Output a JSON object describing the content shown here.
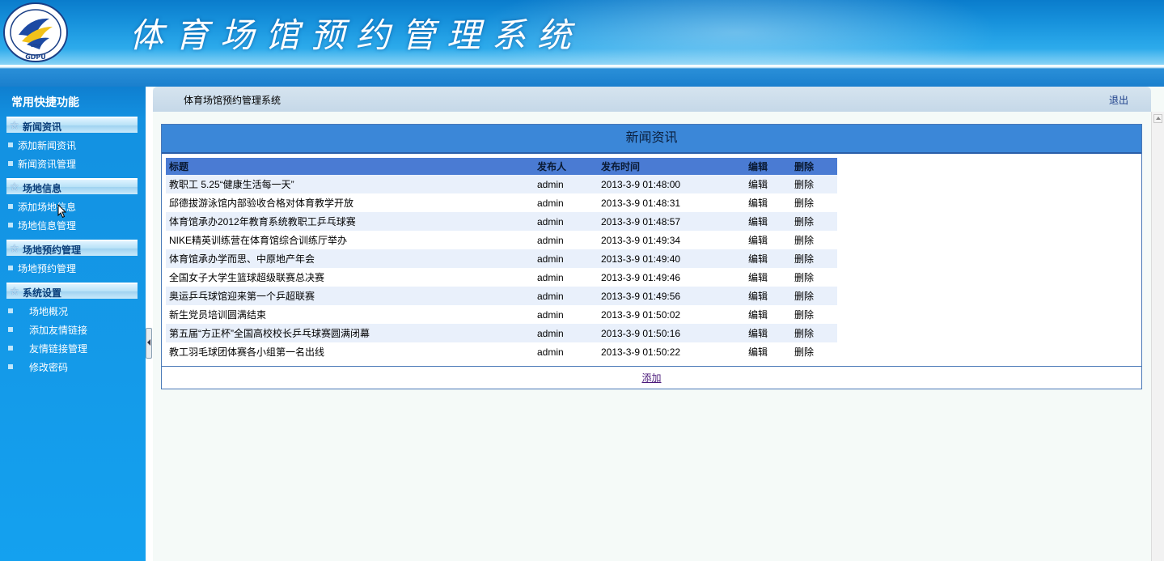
{
  "header": {
    "system_title": "体育场馆预约管理系统",
    "logo": {
      "text_top": "广东体育学院",
      "year": "1958",
      "abbr": "GDPU"
    }
  },
  "sidebar": {
    "title": "常用快捷功能",
    "groups": [
      {
        "label": "新闻资讯",
        "items": [
          {
            "label": "添加新闻资讯"
          },
          {
            "label": "新闻资讯管理"
          }
        ]
      },
      {
        "label": "场地信息",
        "items": [
          {
            "label": "添加场地信息"
          },
          {
            "label": "场地信息管理"
          }
        ]
      },
      {
        "label": "场地预约管理",
        "items": [
          {
            "label": "场地预约管理"
          }
        ]
      },
      {
        "label": "系统设置",
        "items": [
          {
            "label": "场地概况"
          },
          {
            "label": "添加友情链接"
          },
          {
            "label": "友情链接管理"
          },
          {
            "label": "修改密码"
          }
        ]
      }
    ]
  },
  "topbar": {
    "breadcrumb": "体育场馆预约管理系统",
    "logout": "退出"
  },
  "panel": {
    "title": "新闻资讯",
    "columns": [
      "标题",
      "发布人",
      "发布时间",
      "编辑",
      "删除"
    ],
    "rows": [
      {
        "title": "教职工  5.25“健康生活每一天”",
        "author": "admin",
        "time": "2013-3-9 01:48:00",
        "edit": "编辑",
        "delete": "删除"
      },
      {
        "title": "邱德拔游泳馆内部验收合格对体育教学开放",
        "author": "admin",
        "time": "2013-3-9 01:48:31",
        "edit": "编辑",
        "delete": "删除"
      },
      {
        "title": "体育馆承办2012年教育系统教职工乒乓球赛",
        "author": "admin",
        "time": "2013-3-9 01:48:57",
        "edit": "编辑",
        "delete": "删除"
      },
      {
        "title": "NIKE精英训练营在体育馆综合训练厅举办",
        "author": "admin",
        "time": "2013-3-9 01:49:34",
        "edit": "编辑",
        "delete": "删除"
      },
      {
        "title": "体育馆承办学而思、中原地产年会",
        "author": "admin",
        "time": "2013-3-9 01:49:40",
        "edit": "编辑",
        "delete": "删除"
      },
      {
        "title": "全国女子大学生篮球超级联赛总决赛",
        "author": "admin",
        "time": "2013-3-9 01:49:46",
        "edit": "编辑",
        "delete": "删除"
      },
      {
        "title": "奥运乒乓球馆迎来第一个乒超联赛",
        "author": "admin",
        "time": "2013-3-9 01:49:56",
        "edit": "编辑",
        "delete": "删除"
      },
      {
        "title": "新生党员培训圆满结束",
        "author": "admin",
        "time": "2013-3-9 01:50:02",
        "edit": "编辑",
        "delete": "删除"
      },
      {
        "title": "第五届“方正杯”全国高校校长乒乓球赛圆满闭幕",
        "author": "admin",
        "time": "2013-3-9 01:50:16",
        "edit": "编辑",
        "delete": "删除"
      },
      {
        "title": "教工羽毛球团体赛各小组第一名出线",
        "author": "admin",
        "time": "2013-3-9 01:50:22",
        "edit": "编辑",
        "delete": "删除"
      }
    ],
    "add_link": "添加"
  },
  "colors": {
    "header_blue": "#1792dc",
    "sidebar_blue": "#14a1ef",
    "panel_title_blue": "#3b87d8",
    "table_header_blue": "#4a7bd3",
    "row_alt": "#e9f0fb"
  }
}
